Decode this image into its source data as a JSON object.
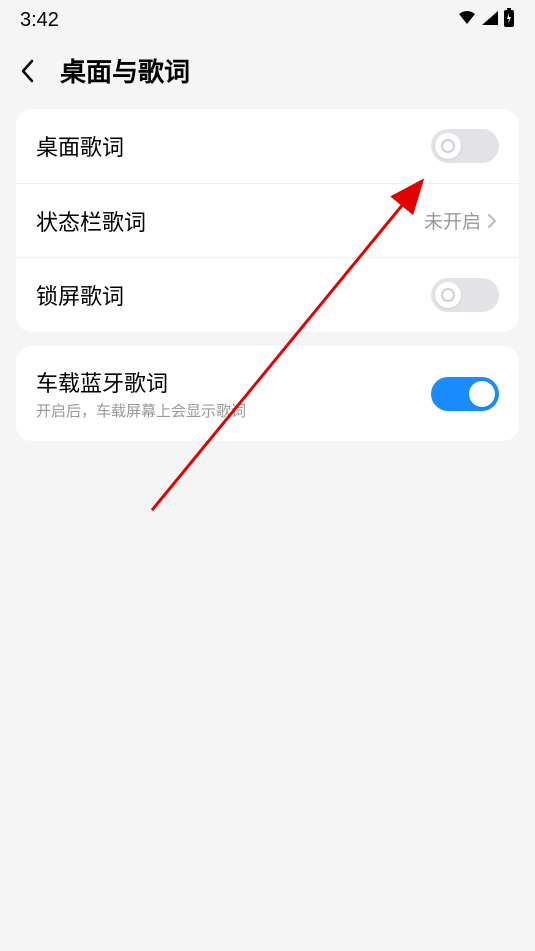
{
  "statusBar": {
    "time": "3:42"
  },
  "header": {
    "title": "桌面与歌词"
  },
  "group1": {
    "row1": {
      "label": "桌面歌词"
    },
    "row2": {
      "label": "状态栏歌词",
      "value": "未开启"
    },
    "row3": {
      "label": "锁屏歌词"
    }
  },
  "group2": {
    "row1": {
      "label": "车载蓝牙歌词",
      "sublabel": "开启后，车载屏幕上会显示歌词"
    }
  }
}
